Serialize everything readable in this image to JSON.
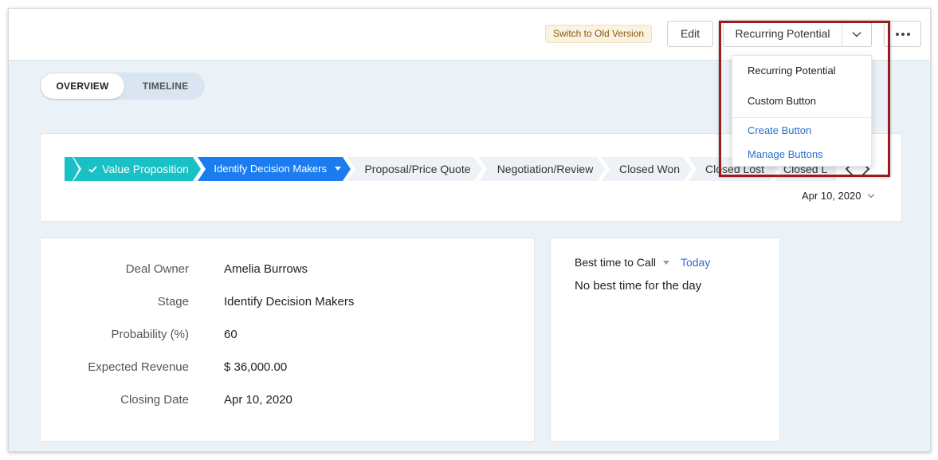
{
  "toolbar": {
    "switch_label": "Switch to Old Version",
    "edit_label": "Edit",
    "custom_button_label": "Recurring Potential"
  },
  "tabs": [
    {
      "label": "OVERVIEW",
      "active": true
    },
    {
      "label": "TIMELINE",
      "active": false
    }
  ],
  "stages": [
    {
      "label": "Value Proposition",
      "status": "done"
    },
    {
      "label": "Identify Decision Makers",
      "status": "current"
    },
    {
      "label": "Proposal/Price Quote",
      "status": "upcoming"
    },
    {
      "label": "Negotiation/Review",
      "status": "upcoming"
    },
    {
      "label": "Closed Won",
      "status": "upcoming"
    },
    {
      "label": "Closed Lost",
      "status": "upcoming"
    },
    {
      "label": "Closed L",
      "status": "upcoming"
    }
  ],
  "stage_date": "Apr 10, 2020",
  "details": [
    {
      "label": "Deal Owner",
      "value": "Amelia Burrows"
    },
    {
      "label": "Stage",
      "value": "Identify Decision Makers"
    },
    {
      "label": "Probability (%)",
      "value": "60"
    },
    {
      "label": "Expected Revenue",
      "value": "$ 36,000.00"
    },
    {
      "label": "Closing Date",
      "value": "Apr 10, 2020"
    }
  ],
  "best_time": {
    "prefix": "Best time to",
    "mode": "Call",
    "link": "Today",
    "status": "No best time for the day"
  },
  "dropdown": {
    "items": [
      "Recurring Potential",
      "Custom Button"
    ],
    "actions": [
      "Create Button",
      "Manage Buttons"
    ]
  },
  "colors": {
    "stage_done": "#19c0c5",
    "stage_current": "#1a7cf0",
    "stage_upcoming": "#eef2f6",
    "link": "#2b6ecf",
    "highlight": "#9b1c1c"
  }
}
